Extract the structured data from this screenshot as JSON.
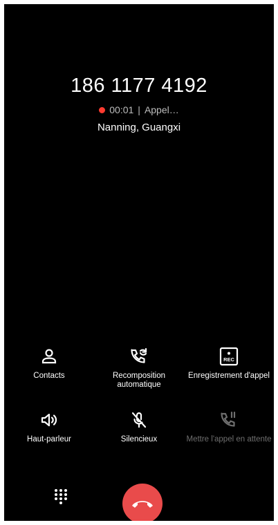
{
  "call": {
    "number": "186 1177 4192",
    "timer": "00:01",
    "separator": "|",
    "state": "Appel…",
    "location": "Nanning, Guangxi"
  },
  "actions": [
    {
      "label": "Contacts",
      "icon": "person-icon"
    },
    {
      "label": "Recomposition automatique",
      "icon": "phone-redial-icon"
    },
    {
      "label": "Enregistrement d'appel",
      "icon": "rec-icon"
    },
    {
      "label": "Haut-parleur",
      "icon": "speaker-icon"
    },
    {
      "label": "Silencieux",
      "icon": "mic-off-icon"
    },
    {
      "label": "Mettre l'appel en attente",
      "icon": "phone-hold-icon",
      "disabled": true
    }
  ],
  "rec_badge": "REC",
  "colors": {
    "background": "#000000",
    "recording_dot": "#ff3b30",
    "end_call": "#e94b4b",
    "disabled": "#6f6f6f"
  }
}
